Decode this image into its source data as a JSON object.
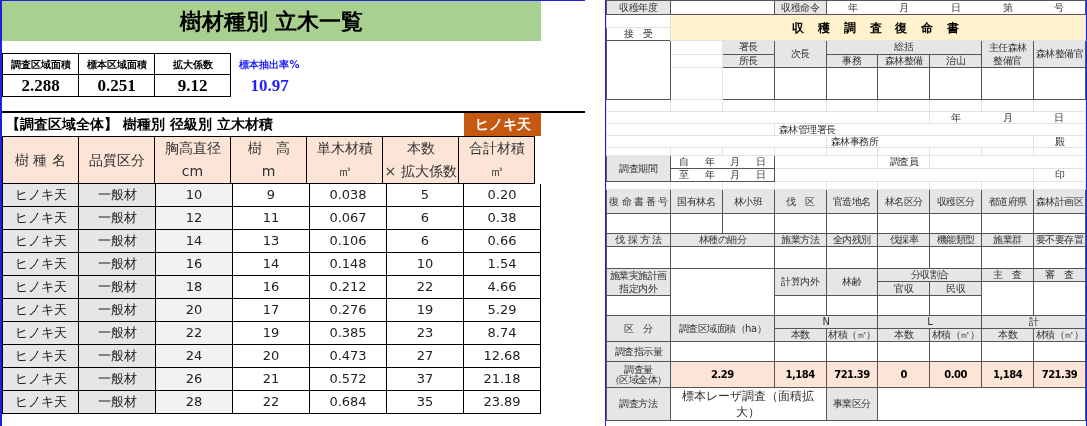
{
  "sheet": {
    "title": "樹材種別 立木一覧",
    "stats": [
      {
        "label": "調査区域面積",
        "value": "2.288",
        "kind": "boxed"
      },
      {
        "label": "標本区域面積",
        "value": "0.251",
        "kind": "boxed"
      },
      {
        "label": "拡大係数",
        "value": "9.12",
        "kind": "boxed"
      },
      {
        "label": "標本抽出率%",
        "value": "10.97",
        "kind": "highlight"
      }
    ],
    "section_title": "【調査区域全体】 樹種別 径級別 立木材積",
    "species_tag": "ヒノキ天",
    "columns": [
      {
        "label": "樹 種 名"
      },
      {
        "label": "品質区分"
      },
      {
        "label": "胸高直径",
        "unit": "cm"
      },
      {
        "label": "樹　高",
        "unit": "m"
      },
      {
        "label": "単木材積",
        "unit": "㎥"
      },
      {
        "label": "本数",
        "unit": "× 拡大係数"
      },
      {
        "label": "合計材積",
        "unit": "㎥"
      }
    ],
    "rows": [
      [
        "ヒノキ天",
        "一般材",
        "10",
        "9",
        "0.038",
        "5",
        "0.20"
      ],
      [
        "ヒノキ天",
        "一般材",
        "12",
        "11",
        "0.067",
        "6",
        "0.38"
      ],
      [
        "ヒノキ天",
        "一般材",
        "14",
        "13",
        "0.106",
        "6",
        "0.66"
      ],
      [
        "ヒノキ天",
        "一般材",
        "16",
        "14",
        "0.148",
        "10",
        "1.54"
      ],
      [
        "ヒノキ天",
        "一般材",
        "18",
        "16",
        "0.212",
        "22",
        "4.66"
      ],
      [
        "ヒノキ天",
        "一般材",
        "20",
        "17",
        "0.276",
        "19",
        "5.29"
      ],
      [
        "ヒノキ天",
        "一般材",
        "22",
        "19",
        "0.385",
        "23",
        "8.74"
      ],
      [
        "ヒノキ天",
        "一般材",
        "24",
        "20",
        "0.473",
        "27",
        "12.68"
      ],
      [
        "ヒノキ天",
        "一般材",
        "26",
        "21",
        "0.572",
        "37",
        "21.18"
      ],
      [
        "ヒノキ天",
        "一般材",
        "28",
        "22",
        "0.684",
        "35",
        "23.89"
      ]
    ]
  },
  "report": {
    "year_label": "収穫年度",
    "order_label": "収穫命令",
    "order_date": [
      "年",
      "月",
      "日",
      "第",
      "号"
    ],
    "reception_label": "接　受",
    "title": "収 穫 調 査 復 命 書",
    "approvals": {
      "chief_top": "署長",
      "chief_bottom": "所長",
      "deputy": "次長",
      "general": "総括",
      "general_parts": [
        "事務",
        "森林整備",
        "治山"
      ],
      "forest_officer": "主任森林整備官",
      "forestry_officer": "森林整備官"
    },
    "date_line": [
      "年",
      "月",
      "日"
    ],
    "addressee": {
      "title": "森林管理署長",
      "office": "森林事務所",
      "honorific": "殿"
    },
    "period": {
      "label": "調査期間",
      "from": [
        "自",
        "年",
        "月",
        "日"
      ],
      "to": [
        "至",
        "年",
        "月",
        "日"
      ]
    },
    "surveyor": {
      "label": "調査員",
      "seal": "印"
    },
    "id_headers": [
      "復 命 書 番 号",
      "国有林名",
      "林小班",
      "伐　区",
      "官造地名",
      "林名区分",
      "収穫区分",
      "都道府県",
      "森林計画区"
    ],
    "method_headers": [
      "伐 採 方 法",
      "林種の細分",
      "施業方法",
      "全内残別",
      "伐採率",
      "機能類型",
      "施業群",
      "要不要存置"
    ],
    "plan": {
      "plan": "施業実施計画指定内外",
      "calc": "計算内外",
      "age": "林齢",
      "share": "分収割合",
      "share_parts": [
        "官収",
        "民収"
      ],
      "main": "主　査",
      "review": "審　査"
    },
    "volume": {
      "category": "区　分",
      "area": "調査区域面積（ha）",
      "groups": [
        "N",
        "L",
        "計"
      ],
      "subheaders": [
        "本数",
        "材積（㎥）",
        "本数",
        "材積（㎥）",
        "本数",
        "材積（㎥）"
      ],
      "rows": [
        {
          "label": "調査指示量",
          "kind": "blank"
        },
        {
          "label": "調査量",
          "note": "（区域全体）",
          "kind": "filled",
          "area": "2.29",
          "values": [
            "1,184",
            "721.39",
            "0",
            "0.00",
            "1,184",
            "721.39"
          ]
        }
      ]
    },
    "method_row": {
      "label": "調査方法",
      "value": "標本レーザ調査（面積拡大）",
      "business_label": "事業区分"
    }
  }
}
